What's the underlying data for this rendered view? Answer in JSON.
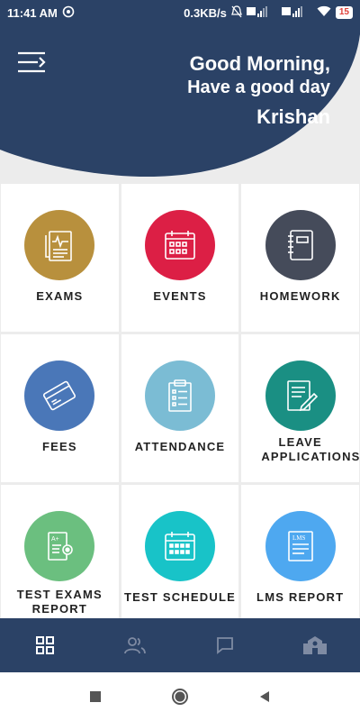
{
  "status_bar": {
    "time": "11:41 AM",
    "speed": "0.3KB/s",
    "battery": "15",
    "icons": [
      "sync-icon",
      "mute-icon",
      "signal-icon",
      "wifi-icon",
      "battery-icon"
    ]
  },
  "header": {
    "greeting_line1": "Good Morning,",
    "greeting_line2": "Have a good day",
    "user_name": "Krishan",
    "background_color": "#2b4266"
  },
  "tiles": [
    {
      "label": "EXAMS",
      "color": "#b8903d",
      "icon": "exam-report-icon"
    },
    {
      "label": "EVENTS",
      "color": "#dc1f45",
      "icon": "calendar-icon"
    },
    {
      "label": "HOMEWORK",
      "color": "#454b5a",
      "icon": "notebook-icon"
    },
    {
      "label": "FEES",
      "color": "#4a77b8",
      "icon": "card-icon"
    },
    {
      "label": "ATTENDANCE",
      "color": "#7bbcd4",
      "icon": "clipboard-icon"
    },
    {
      "label": "LEAVE APPLICATIONS",
      "color": "#1a8f83",
      "icon": "document-edit-icon"
    },
    {
      "label": "TEST EXAMS REPORT",
      "color": "#6bbf7f",
      "icon": "test-report-icon"
    },
    {
      "label": "TEST SCHEDULE",
      "color": "#18c3c8",
      "icon": "schedule-icon"
    },
    {
      "label": "LMS REPORT",
      "color": "#4ea8f0",
      "icon": "lms-icon"
    }
  ],
  "bottom_nav": [
    "dashboard-icon",
    "people-icon",
    "chat-icon",
    "school-icon"
  ],
  "system_nav": [
    "recents-icon",
    "home-icon",
    "back-icon"
  ]
}
